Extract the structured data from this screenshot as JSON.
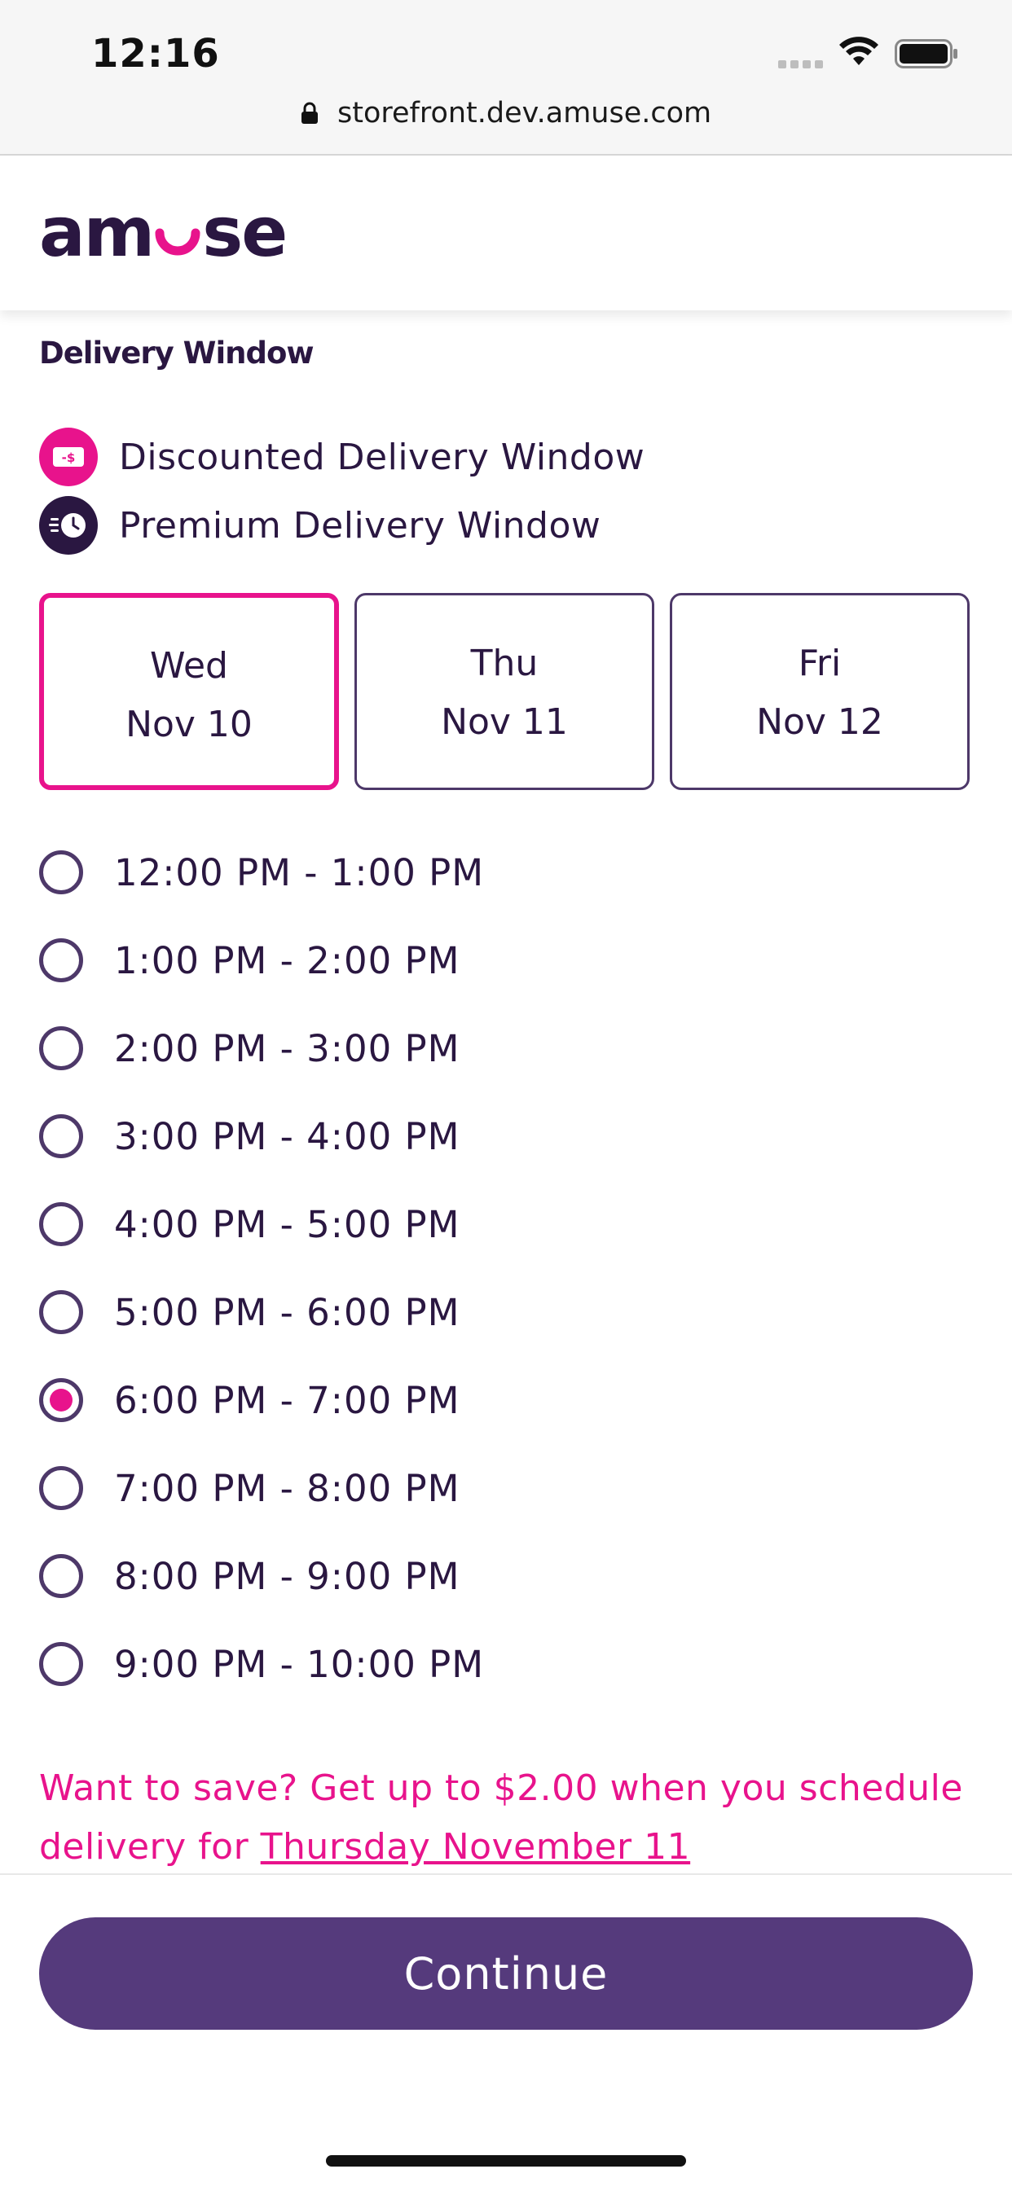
{
  "status_bar": {
    "time": "12:16"
  },
  "browser": {
    "url": "storefront.dev.amuse.com"
  },
  "header": {
    "logo_prefix": "am",
    "logo_suffix": "se"
  },
  "delivery": {
    "title": "Delivery Window",
    "legend": [
      {
        "label": "Discounted Delivery Window",
        "icon": "discount-tag-icon"
      },
      {
        "label": "Premium Delivery Window",
        "icon": "fast-clock-icon"
      }
    ],
    "days": [
      {
        "dow": "Wed",
        "date": "Nov 10",
        "selected": true
      },
      {
        "dow": "Thu",
        "date": "Nov 11",
        "selected": false
      },
      {
        "dow": "Fri",
        "date": "Nov 12",
        "selected": false
      }
    ],
    "slots": [
      {
        "label": "12:00 PM - 1:00 PM",
        "checked": false
      },
      {
        "label": "1:00 PM - 2:00 PM",
        "checked": false
      },
      {
        "label": "2:00 PM - 3:00 PM",
        "checked": false
      },
      {
        "label": "3:00 PM - 4:00 PM",
        "checked": false
      },
      {
        "label": "4:00 PM - 5:00 PM",
        "checked": false
      },
      {
        "label": "5:00 PM - 6:00 PM",
        "checked": false
      },
      {
        "label": "6:00 PM - 7:00 PM",
        "checked": true
      },
      {
        "label": "7:00 PM - 8:00 PM",
        "checked": false
      },
      {
        "label": "8:00 PM - 9:00 PM",
        "checked": false
      },
      {
        "label": "9:00 PM - 10:00 PM",
        "checked": false
      }
    ],
    "promo_text": "Want to save? Get up to $2.00 when you schedule delivery for ",
    "promo_link": "Thursday November 11"
  },
  "footer": {
    "continue_label": "Continue"
  },
  "colors": {
    "brand_pink": "#e8138c",
    "brand_purple": "#553a7c",
    "text_dark": "#2a1741"
  }
}
